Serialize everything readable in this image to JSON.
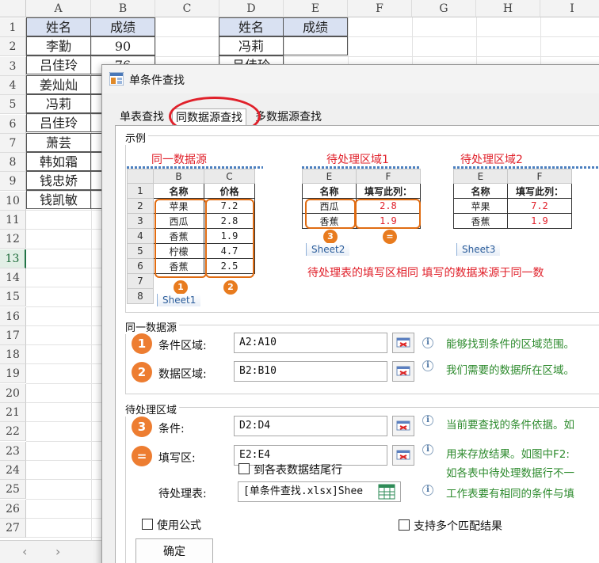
{
  "sheet": {
    "columns": [
      "A",
      "B",
      "C",
      "D",
      "E",
      "F",
      "G",
      "H",
      "I"
    ],
    "rows": [
      "1",
      "2",
      "3",
      "4",
      "5",
      "6",
      "7",
      "8",
      "9",
      "10",
      "11",
      "12",
      "13",
      "14",
      "15",
      "16",
      "17",
      "18",
      "19",
      "20",
      "21",
      "22",
      "23",
      "24",
      "25",
      "26",
      "27"
    ],
    "selected_row": "13",
    "table1": {
      "headers": [
        "姓名",
        "成绩"
      ],
      "names": [
        "李勤",
        "吕佳玲",
        "姜灿灿",
        "冯莉",
        "吕佳玲",
        "萧芸",
        "韩如霜",
        "钱忠娇",
        "钱凯敏"
      ],
      "scores": [
        "90",
        "76"
      ]
    },
    "table2": {
      "headers": [
        "姓名",
        "成绩"
      ],
      "names": [
        "冯莉",
        "吕佳玲"
      ]
    }
  },
  "dialog": {
    "title": "单条件查找",
    "tabs": [
      "单表查找",
      "同数据源查找",
      "多数据源查找"
    ],
    "active_tab": 1,
    "example": {
      "group_label": "示例",
      "label_source": "同一数据源",
      "label_target1": "待处理区域1",
      "label_target2": "待处理区域2",
      "src": {
        "col_headers": [
          "B",
          "C"
        ],
        "row_numbers": [
          "1",
          "2",
          "3",
          "4",
          "5",
          "6",
          "7",
          "8"
        ],
        "header": [
          "名称",
          "价格"
        ],
        "names": [
          "苹果",
          "西瓜",
          "香蕉",
          "柠檬",
          "香蕉"
        ],
        "prices": [
          "7.2",
          "2.8",
          "1.9",
          "4.7",
          "2.5"
        ],
        "sheet": "Sheet1"
      },
      "t1": {
        "col_headers": [
          "E",
          "F"
        ],
        "header": [
          "名称",
          "填写此列："
        ],
        "names": [
          "西瓜",
          "香蕉"
        ],
        "values": [
          "2.8",
          "1.9"
        ],
        "sheet": "Sheet2"
      },
      "t2": {
        "col_headers": [
          "E",
          "F"
        ],
        "header": [
          "名称",
          "填写此列："
        ],
        "names": [
          "苹果",
          "香蕉"
        ],
        "values": [
          "7.2",
          "1.9"
        ],
        "sheet": "Sheet3"
      },
      "badges": [
        "1",
        "2",
        "3",
        "="
      ],
      "note": "待处理表的填写区相同 填写的数据来源于同一数"
    },
    "source_group": {
      "label": "同一数据源",
      "cond_label": "条件区域:",
      "cond_value": "A2:A10",
      "cond_hint": "能够找到条件的区域范围。",
      "data_label": "数据区域:",
      "data_value": "B2:B10",
      "data_hint": "我们需要的数据所在区域。"
    },
    "target_group": {
      "label": "待处理区域",
      "cond_label": "条件:",
      "cond_value": "D2:D4",
      "cond_hint": "当前要查找的条件依据。如",
      "fill_label": "填写区:",
      "fill_value": "E2:E4",
      "fill_hint": "用来存放结果。如图中F2:",
      "extend_label": "到各表数据结尾行",
      "extend_hint": "如各表中待处理数据行不一",
      "table_label": "待处理表:",
      "table_value": "[单条件查找.xlsx]Shee",
      "table_hint": "工作表要有相同的条件与填"
    },
    "use_formula": "使用公式",
    "multi_match": "支持多个匹配结果",
    "ok": "确定"
  },
  "colors": {
    "accent_orange": "#ed7d31",
    "red": "#e0202a",
    "hint_green": "#2e8b2e",
    "header_blue": "#d9e1f2",
    "excel_green": "#217346"
  }
}
